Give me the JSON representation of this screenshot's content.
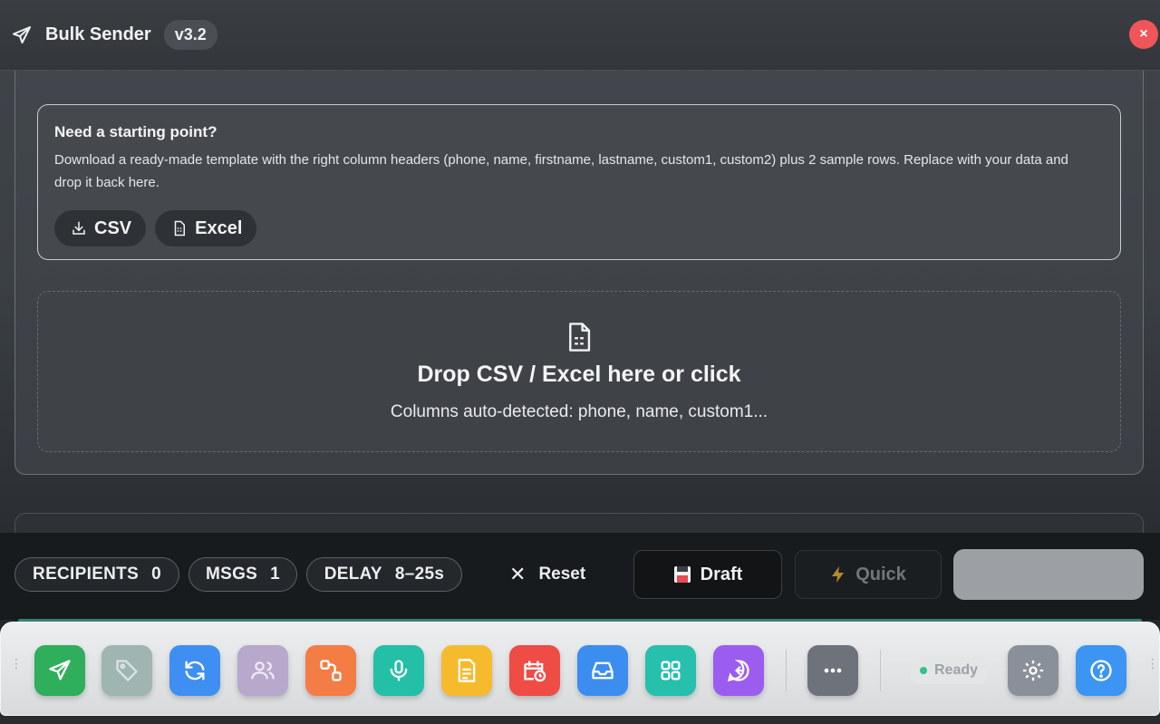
{
  "header": {
    "title": "Bulk Sender",
    "version": "v3.2",
    "close_label": "×"
  },
  "hint": {
    "title": "Need a starting point?",
    "body": "Download a ready-made template with the right column headers (phone, name, firstname, lastname, custom1, custom2) plus 2 sample rows. Replace with your data and drop it back here.",
    "csv_label": "CSV",
    "excel_label": "Excel"
  },
  "dropzone": {
    "title": "Drop CSV / Excel here or click",
    "subtitle": "Columns auto-detected: phone, name, custom1..."
  },
  "actionbar": {
    "recipients_label": "RECIPIENTS",
    "recipients_value": "0",
    "msgs_label": "MSGS",
    "msgs_value": "1",
    "delay_label": "DELAY",
    "delay_value": "8–25s",
    "reset_label": "Reset",
    "draft_label": "Draft",
    "quick_label": "Quick"
  },
  "dock": {
    "status": "Ready",
    "tiles": [
      {
        "icon": "send-icon",
        "color": "#2fae5b"
      },
      {
        "icon": "tag-icon",
        "color": "#9fb5b2"
      },
      {
        "icon": "refresh-icon",
        "color": "#3f8ff2"
      },
      {
        "icon": "users-icon",
        "color": "#b7a8cc"
      },
      {
        "icon": "workflow-icon",
        "color": "#f47c45"
      },
      {
        "icon": "microphone-icon",
        "color": "#24bfa7"
      },
      {
        "icon": "document-icon",
        "color": "#f6bb2c"
      },
      {
        "icon": "calendar-clock-icon",
        "color": "#ef4c45"
      },
      {
        "icon": "inbox-icon",
        "color": "#3b8df0"
      },
      {
        "icon": "grid-icon",
        "color": "#26c0ad"
      },
      {
        "icon": "chat-reply-icon",
        "color": "#9b5cf0"
      },
      {
        "icon": "more-icon",
        "color": "#6e737b"
      },
      {
        "icon": "gear-icon",
        "color": "#8a9099"
      },
      {
        "icon": "help-icon",
        "color": "#3c95f3"
      }
    ]
  }
}
